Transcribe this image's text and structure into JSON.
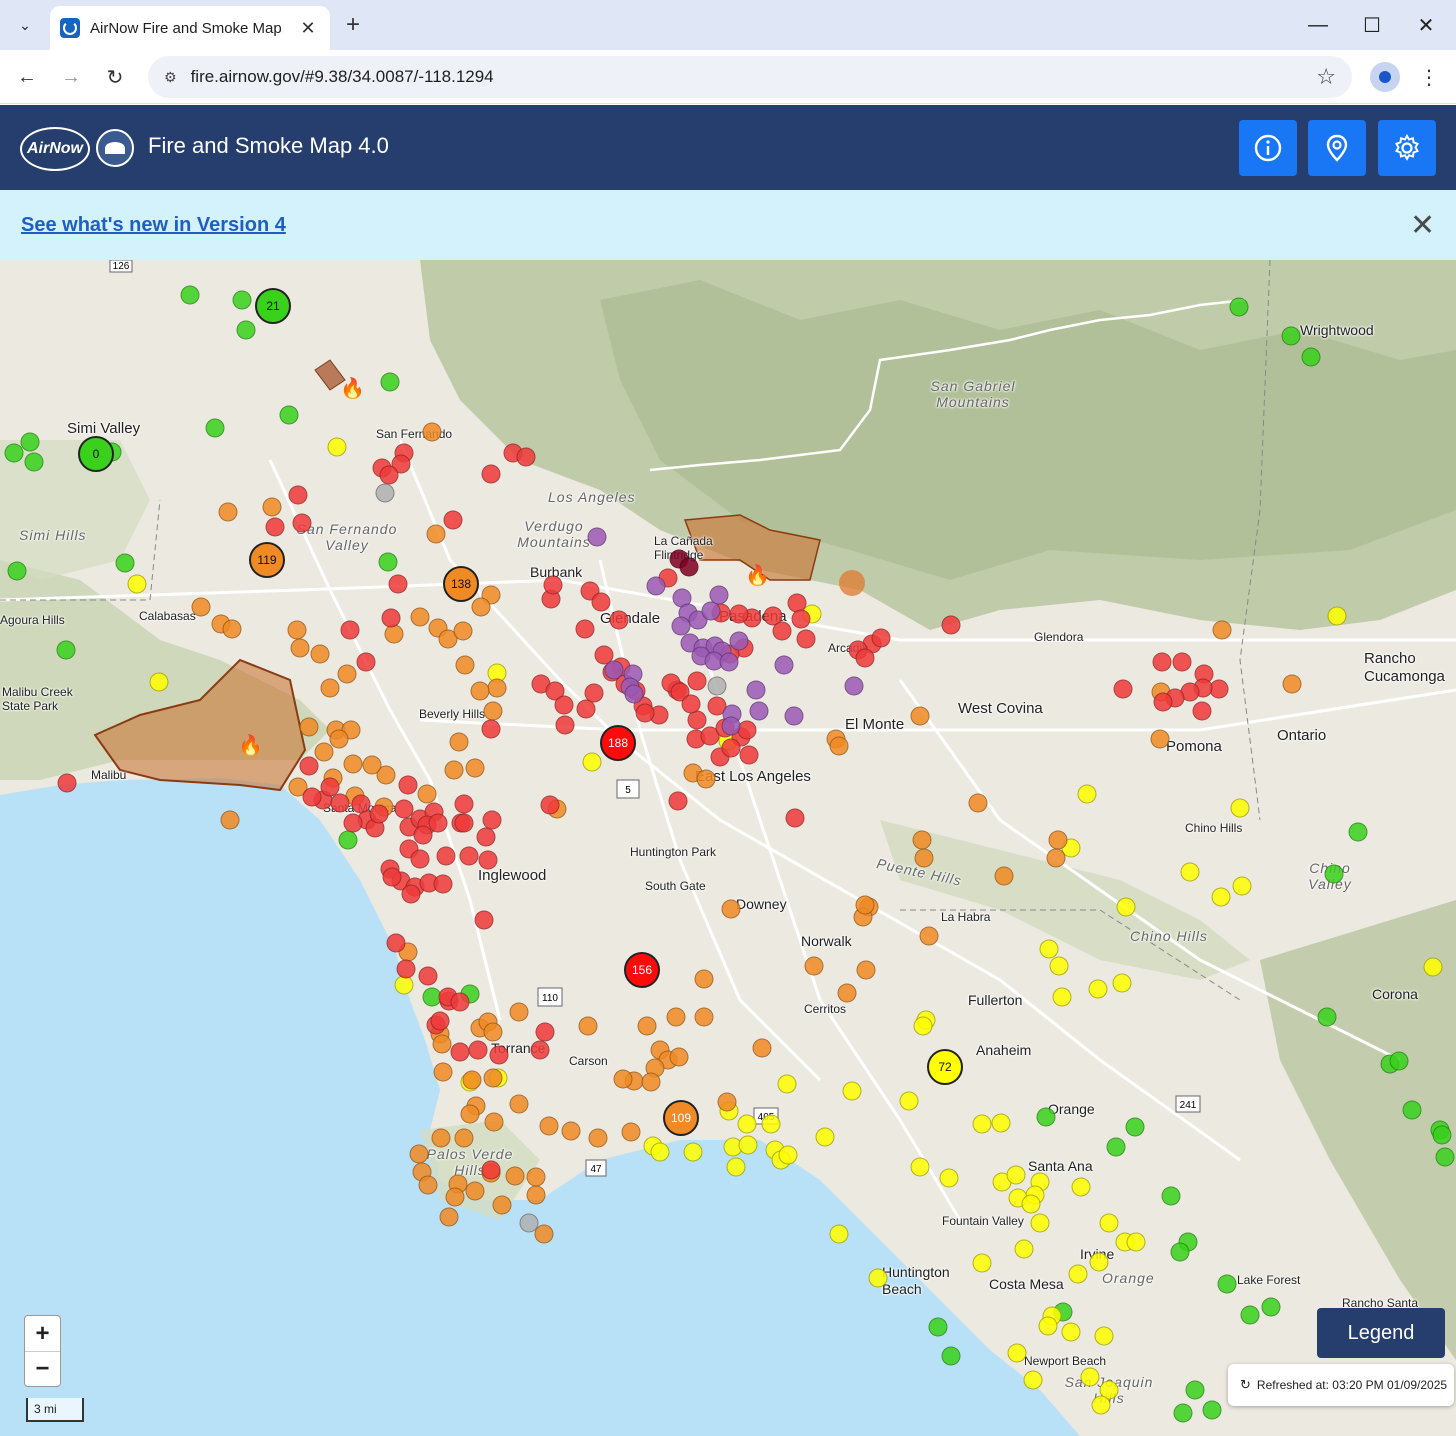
{
  "browser": {
    "tab_title": "AirNow Fire and Smoke Map",
    "url": "fire.airnow.gov/#9.38/34.0087/-118.1294"
  },
  "header": {
    "logo_text": "AirNow",
    "title": "Fire and Smoke Map 4.0"
  },
  "banner": {
    "link_text": "See what's new in Version 4"
  },
  "map": {
    "terrain_labels": [
      "San Gabriel Mountains",
      "Los Angeles",
      "Verdugo Mountains",
      "San Fernando Valley",
      "Simi Hills",
      "Malibu Creek State Park",
      "Puente Hills",
      "Chino Hills",
      "Chino Valley",
      "Palos Verde Hills",
      "San Joaquin Hills",
      "Orange"
    ],
    "places": [
      "Wrightwood",
      "Simi Valley",
      "San Fernando",
      "Calabasas",
      "Agoura Hills",
      "Burbank",
      "La Cañada Flintridge",
      "Glendale",
      "Pasadena",
      "Arcadia",
      "Glendora",
      "Rancho Cucamonga",
      "Beverly Hills",
      "Malibu",
      "Santa Monica",
      "El Monte",
      "West Covina",
      "Pomona",
      "Ontario",
      "East Los Angeles",
      "Chino Hills",
      "Huntington Park",
      "Inglewood",
      "South Gate",
      "Downey",
      "La Habra",
      "Norwalk",
      "Corona",
      "Cerritos",
      "Fullerton",
      "Anaheim",
      "Torrance",
      "Carson",
      "Orange",
      "Santa Ana",
      "Fountain Valley",
      "Huntington Beach",
      "Costa Mesa",
      "Irvine",
      "Lake Forest",
      "Rancho Santa",
      "Newport Beach"
    ],
    "highway_shields": [
      "126",
      "5",
      "110",
      "47",
      "405",
      "241"
    ],
    "monitors": [
      {
        "label": "21",
        "color": "#39d11c"
      },
      {
        "label": "0",
        "color": "#39d11c"
      },
      {
        "label": "119",
        "color": "#f08a24"
      },
      {
        "label": "138",
        "color": "#f08a24"
      },
      {
        "label": "188",
        "color": "#ff0a0a"
      },
      {
        "label": "156",
        "color": "#ff0a0a"
      },
      {
        "label": "109",
        "color": "#f08a24"
      },
      {
        "label": "72",
        "color": "#ffff00"
      }
    ],
    "scale_label": "3 mi",
    "zoom_in": "+",
    "zoom_out": "−",
    "legend_label": "Legend",
    "refreshed_text": "Refreshed at: 03:20 PM 01/09/2025"
  },
  "colors": {
    "good": "#39d11c",
    "moderate": "#ffff00",
    "usg": "#f08a24",
    "unhealthy": "#ef3a3a",
    "very_unhealthy": "#9b59b6",
    "hazardous": "#7e0023",
    "no_data": "#b0b0b0"
  },
  "icons": {
    "info": "info-icon",
    "location": "location-pin-icon",
    "settings": "gear-icon",
    "refresh": "refresh-icon"
  }
}
